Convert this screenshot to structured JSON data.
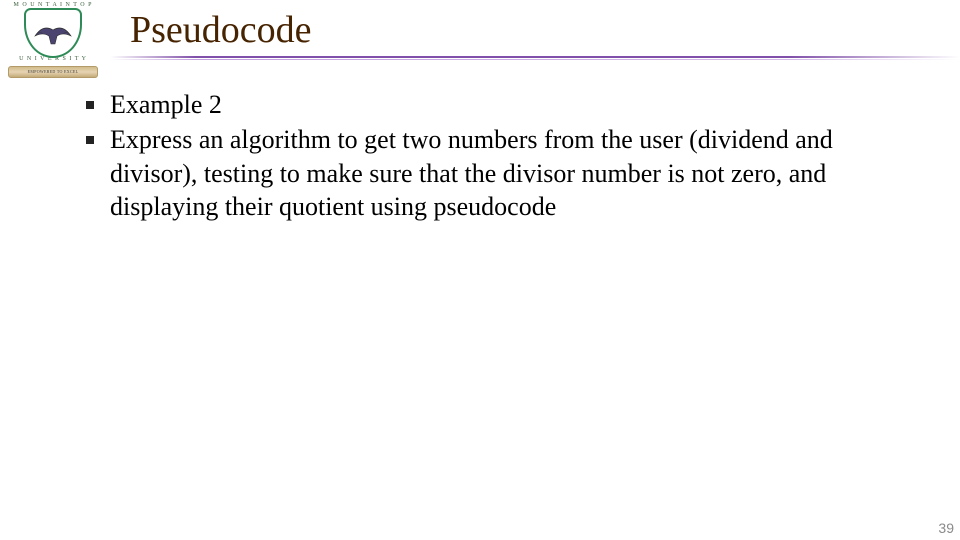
{
  "slide": {
    "title": "Pseudocode",
    "page_number": "39"
  },
  "logo": {
    "arc_top": "M O U N T A I N   T O P",
    "arc_bottom": "U N I V E R S I T Y",
    "band_text": "EMPOWERED TO EXCEL"
  },
  "bullets": {
    "0": "Example 2",
    "1": "Express an algorithm to get two numbers from the user (dividend and divisor), testing to make sure that the divisor number is not zero, and displaying their quotient using pseudocode"
  }
}
